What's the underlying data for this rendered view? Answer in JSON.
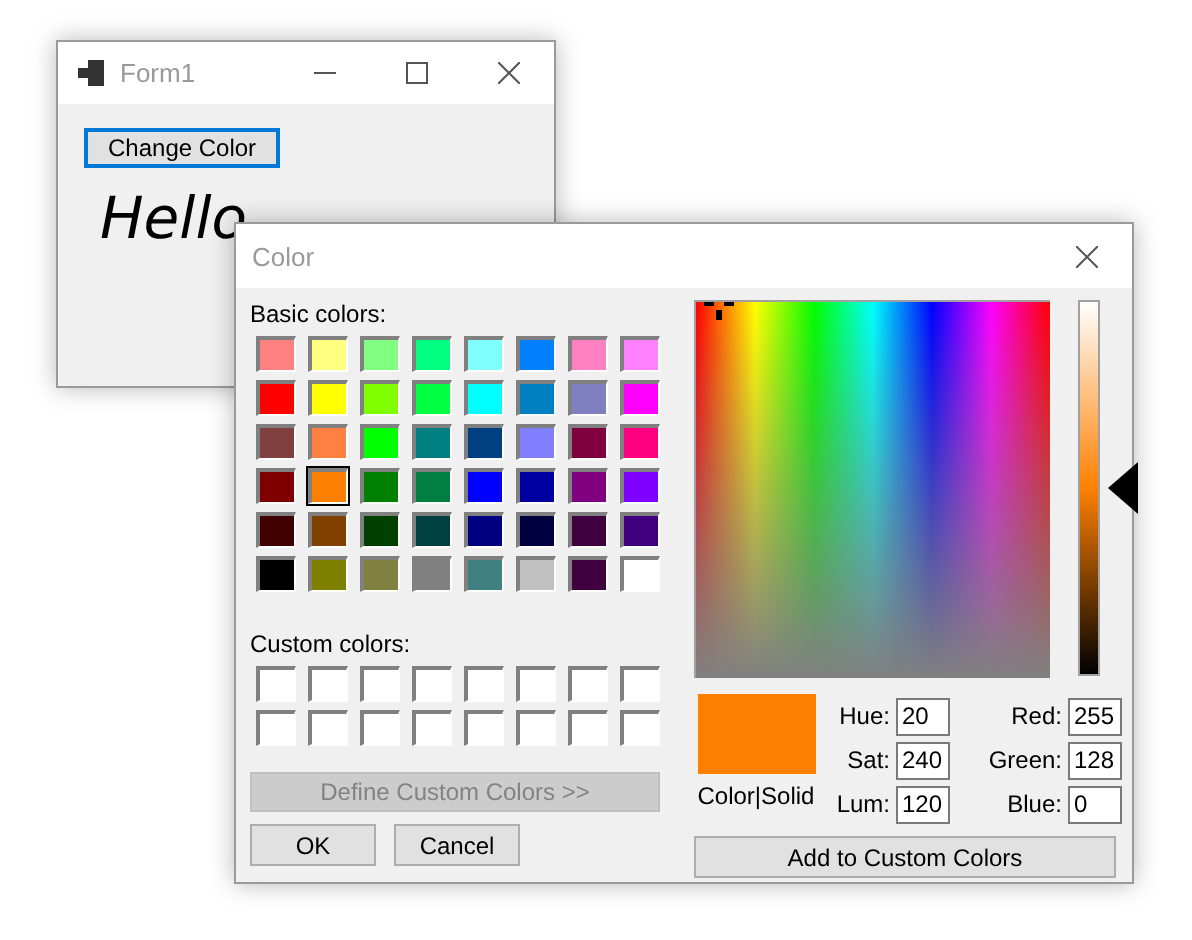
{
  "form_window": {
    "title": "Form1",
    "change_button": "Change Color",
    "greeting": "Hello"
  },
  "color_dialog": {
    "title": "Color",
    "basic_colors_label": "Basic colors:",
    "basic_colors": [
      {
        "color": "#ff8080",
        "selected": false
      },
      {
        "color": "#ffff80",
        "selected": false
      },
      {
        "color": "#80ff80",
        "selected": false
      },
      {
        "color": "#00ff80",
        "selected": false
      },
      {
        "color": "#80ffff",
        "selected": false
      },
      {
        "color": "#0080ff",
        "selected": false
      },
      {
        "color": "#ff80c0",
        "selected": false
      },
      {
        "color": "#ff80ff",
        "selected": false
      },
      {
        "color": "#ff0000",
        "selected": false
      },
      {
        "color": "#ffff00",
        "selected": false
      },
      {
        "color": "#80ff00",
        "selected": false
      },
      {
        "color": "#00ff40",
        "selected": false
      },
      {
        "color": "#00ffff",
        "selected": false
      },
      {
        "color": "#0080c0",
        "selected": false
      },
      {
        "color": "#8080c0",
        "selected": false
      },
      {
        "color": "#ff00ff",
        "selected": false
      },
      {
        "color": "#804040",
        "selected": false
      },
      {
        "color": "#ff8040",
        "selected": false
      },
      {
        "color": "#00ff00",
        "selected": false
      },
      {
        "color": "#008080",
        "selected": false
      },
      {
        "color": "#004080",
        "selected": false
      },
      {
        "color": "#8080ff",
        "selected": false
      },
      {
        "color": "#800040",
        "selected": false
      },
      {
        "color": "#ff0080",
        "selected": false
      },
      {
        "color": "#800000",
        "selected": false
      },
      {
        "color": "#ff8000",
        "selected": true
      },
      {
        "color": "#008000",
        "selected": false
      },
      {
        "color": "#008040",
        "selected": false
      },
      {
        "color": "#0000ff",
        "selected": false
      },
      {
        "color": "#0000a0",
        "selected": false
      },
      {
        "color": "#800080",
        "selected": false
      },
      {
        "color": "#8000ff",
        "selected": false
      },
      {
        "color": "#400000",
        "selected": false
      },
      {
        "color": "#804000",
        "selected": false
      },
      {
        "color": "#004000",
        "selected": false
      },
      {
        "color": "#004040",
        "selected": false
      },
      {
        "color": "#000080",
        "selected": false
      },
      {
        "color": "#000040",
        "selected": false
      },
      {
        "color": "#400040",
        "selected": false
      },
      {
        "color": "#400080",
        "selected": false
      },
      {
        "color": "#000000",
        "selected": false
      },
      {
        "color": "#808000",
        "selected": false
      },
      {
        "color": "#808040",
        "selected": false
      },
      {
        "color": "#808080",
        "selected": false
      },
      {
        "color": "#408080",
        "selected": false
      },
      {
        "color": "#c0c0c0",
        "selected": false
      },
      {
        "color": "#400040",
        "selected": false
      },
      {
        "color": "#ffffff",
        "selected": false
      }
    ],
    "custom_colors_label": "Custom colors:",
    "custom_colors": [
      {
        "color": "#ffffff"
      },
      {
        "color": "#ffffff"
      },
      {
        "color": "#ffffff"
      },
      {
        "color": "#ffffff"
      },
      {
        "color": "#ffffff"
      },
      {
        "color": "#ffffff"
      },
      {
        "color": "#ffffff"
      },
      {
        "color": "#ffffff"
      },
      {
        "color": "#ffffff"
      },
      {
        "color": "#ffffff"
      },
      {
        "color": "#ffffff"
      },
      {
        "color": "#ffffff"
      },
      {
        "color": "#ffffff"
      },
      {
        "color": "#ffffff"
      },
      {
        "color": "#ffffff"
      },
      {
        "color": "#ffffff"
      }
    ],
    "define_button": {
      "label": "Define Custom Colors >>",
      "disabled": true
    },
    "ok_button": "OK",
    "cancel_button": "Cancel",
    "lum_slider": {
      "level": 0.5
    },
    "preview": {
      "color": "#ff8000",
      "label": "Color|Solid"
    },
    "fields": [
      {
        "label": "Hue:",
        "value": "20"
      },
      {
        "label": "Sat:",
        "value": "240"
      },
      {
        "label": "Lum:",
        "value": "120"
      },
      {
        "label": "Red:",
        "value": "255"
      },
      {
        "label": "Green:",
        "value": "128"
      },
      {
        "label": "Blue:",
        "value": "0"
      }
    ],
    "add_button": "Add to Custom Colors"
  }
}
